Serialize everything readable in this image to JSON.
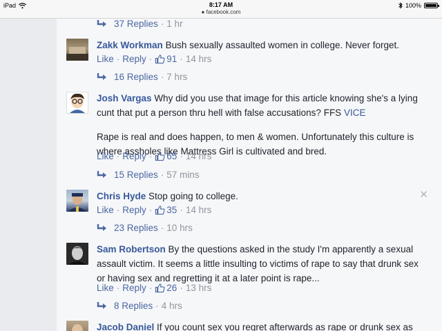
{
  "status_bar": {
    "device": "iPad",
    "time": "8:17 AM",
    "url": "facebook.com",
    "battery": "100%"
  },
  "comments": [
    {
      "replies": {
        "label": "37 Replies",
        "time": "1 hr"
      }
    },
    {
      "author": "Zakk Workman",
      "text": "Bush sexually assaulted women in college. Never forget.",
      "like": "Like",
      "reply": "Reply",
      "likes": "91",
      "time": "14 hrs",
      "replies": {
        "label": "16 Replies",
        "time": "7 hrs"
      }
    },
    {
      "author": "Josh Vargas",
      "text": "Why did you use that image for this article knowing she's a lying cunt that put a person thru hell with false accusations? FFS",
      "link": "VICE",
      "text2": "Rape is real and does happen, to men & women. Unfortunately this culture is where assholes like Mattress Girl is cultivated and bred.",
      "like": "Like",
      "reply": "Reply",
      "likes": "65",
      "time": "14 hrs",
      "replies": {
        "label": "15 Replies",
        "time": "57 mins"
      }
    },
    {
      "author": "Chris Hyde",
      "text": "Stop going to college.",
      "like": "Like",
      "reply": "Reply",
      "likes": "35",
      "time": "14 hrs",
      "replies": {
        "label": "23 Replies",
        "time": "10 hrs"
      },
      "close": "✕"
    },
    {
      "author": "Sam Robertson",
      "text": "By the questions asked in the study I'm apparently a sexual assault victim. It seems a little insulting to victims of rape to say that drunk sex or having sex and regretting it at a later point is rape...",
      "like": "Like",
      "reply": "Reply",
      "likes": "26",
      "time": "13 hrs",
      "replies": {
        "label": "8 Replies",
        "time": "4 hrs"
      }
    },
    {
      "author": "Jacob Daniel",
      "text": "If you count sex you regret afterwards as rape or drunk sex as"
    }
  ],
  "colors": {
    "author": "#365899",
    "action": "#4b67a1",
    "meta": "#90949c",
    "panel": "#f6f7f9",
    "page": "#e9ebee"
  }
}
